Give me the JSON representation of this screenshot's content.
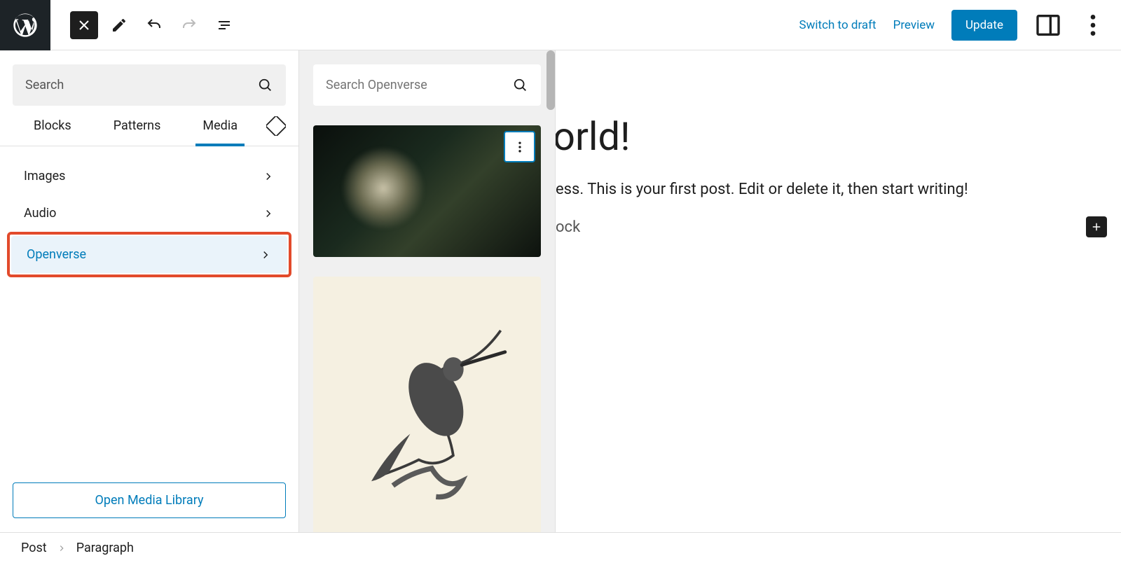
{
  "topbar": {
    "switch_draft": "Switch to draft",
    "preview": "Preview",
    "update": "Update"
  },
  "inserter": {
    "search_placeholder": "Search",
    "tabs": {
      "blocks": "Blocks",
      "patterns": "Patterns",
      "media": "Media"
    },
    "categories": {
      "images": "Images",
      "audio": "Audio",
      "openverse": "Openverse"
    },
    "open_media_library": "Open Media Library"
  },
  "openverse": {
    "search_placeholder": "Search Openverse"
  },
  "editor": {
    "title_fragment": "orld!",
    "body_fragment": "ess. This is your first post. Edit or delete it, then start writing!",
    "placeholder_fragment": "ock"
  },
  "breadcrumb": {
    "root": "Post",
    "current": "Paragraph"
  }
}
